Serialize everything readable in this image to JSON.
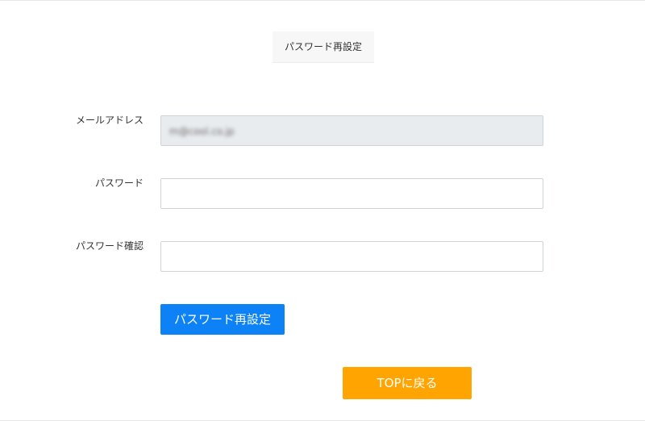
{
  "header": {
    "title": "パスワード再設定"
  },
  "form": {
    "email_label": "メールアドレス",
    "email_value": "m@cool.co.jp",
    "password_label": "パスワード",
    "password_value": "",
    "password_confirm_label": "パスワード確認",
    "password_confirm_value": "",
    "submit_label": "パスワード再設定"
  },
  "footer": {
    "top_button_label": "TOPに戻る"
  },
  "colors": {
    "primary_button": "#0d82f7",
    "top_button": "#ffa400",
    "readonly_field": "#e9ecef"
  }
}
